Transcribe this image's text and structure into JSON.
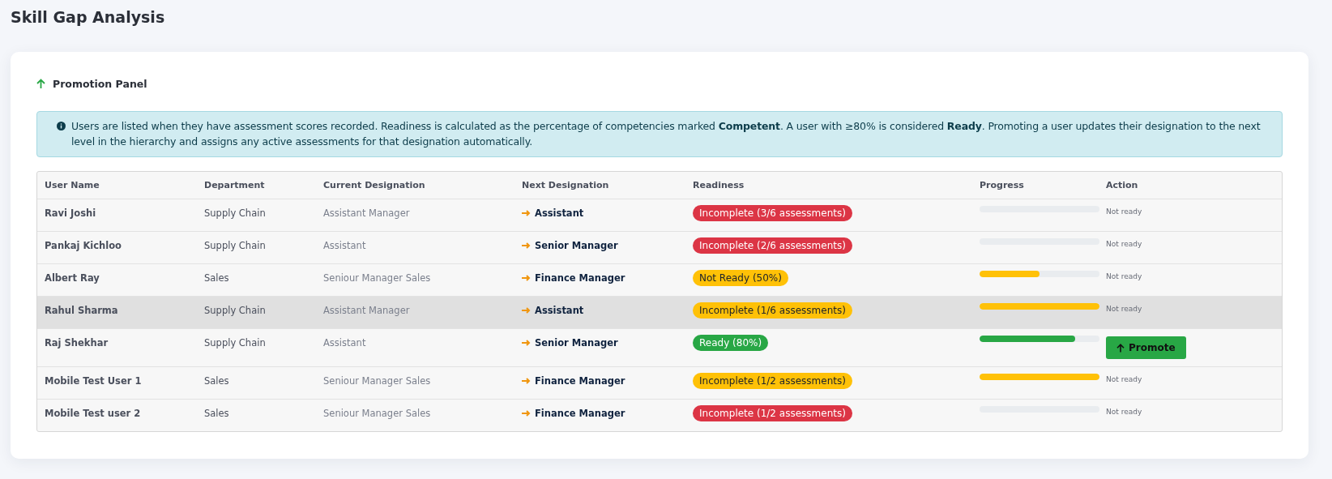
{
  "page_title": "Skill Gap Analysis",
  "panel": {
    "title": "Promotion Panel",
    "info": "Users are listed when they have assessment scores recorded. Readiness is calculated as the percentage of competencies marked **Competent**. A user with ≥80% is considered **Ready**. Promoting a user updates their designation to the next level in the hierarchy and assigns any active assessments for that designation automatically.",
    "table": {
      "columns": [
        "User Name",
        "Department",
        "Current Designation",
        "Next Designation",
        "Readiness",
        "Progress",
        "Action"
      ],
      "rows": [
        {
          "user_name": "Ravi Joshi",
          "department": "Supply Chain",
          "current": "Assistant Manager",
          "next": "Assistant",
          "readiness": {
            "text": "Incomplete (3/6 assessments)",
            "kind": "danger"
          },
          "progress": {
            "level": 0
          },
          "action": {
            "kind": "text",
            "label": "Not ready"
          },
          "selected": false
        },
        {
          "user_name": "Pankaj Kichloo",
          "department": "Supply Chain",
          "current": "Assistant",
          "next": "Senior Manager",
          "readiness": {
            "text": "Incomplete (2/6 assessments)",
            "kind": "danger"
          },
          "progress": {
            "level": 0
          },
          "action": {
            "kind": "text",
            "label": "Not ready"
          },
          "selected": false
        },
        {
          "user_name": "Albert Ray",
          "department": "Sales",
          "current": "Seniour Manager Sales",
          "next": "Finance Manager",
          "readiness": {
            "text": "Not Ready (50%)",
            "kind": "warning"
          },
          "progress": {
            "level": 0.5,
            "color": "#ffc107"
          },
          "action": {
            "kind": "text",
            "label": "Not ready"
          },
          "selected": false
        },
        {
          "user_name": "Rahul Sharma",
          "department": "Supply Chain",
          "current": "Assistant Manager",
          "next": "Assistant",
          "readiness": {
            "text": "Incomplete (1/6 assessments)",
            "kind": "warning"
          },
          "progress": {
            "level": 1,
            "color": "#ffc107"
          },
          "action": {
            "kind": "text",
            "label": "Not ready"
          },
          "selected": true
        },
        {
          "user_name": "Raj Shekhar",
          "department": "Supply Chain",
          "current": "Assistant",
          "next": "Senior Manager",
          "readiness": {
            "text": "Ready (80%)",
            "kind": "success"
          },
          "progress": {
            "level": 0.8,
            "color": "#28a745"
          },
          "action": {
            "kind": "button",
            "label": "Promote"
          },
          "selected": false
        },
        {
          "user_name": "Mobile Test User 1",
          "department": "Sales",
          "current": "Seniour Manager Sales",
          "next": "Finance Manager",
          "readiness": {
            "text": "Incomplete (1/2 assessments)",
            "kind": "warning"
          },
          "progress": {
            "level": 1,
            "color": "#ffc107"
          },
          "action": {
            "kind": "text",
            "label": "Not ready"
          },
          "selected": false
        },
        {
          "user_name": "Mobile Test user 2",
          "department": "Sales",
          "current": "Seniour Manager Sales",
          "next": "Finance Manager",
          "readiness": {
            "text": "Incomplete (1/2 assessments)",
            "kind": "danger"
          },
          "progress": {
            "level": 0
          },
          "action": {
            "kind": "text",
            "label": "Not ready"
          },
          "selected": false
        }
      ]
    }
  }
}
